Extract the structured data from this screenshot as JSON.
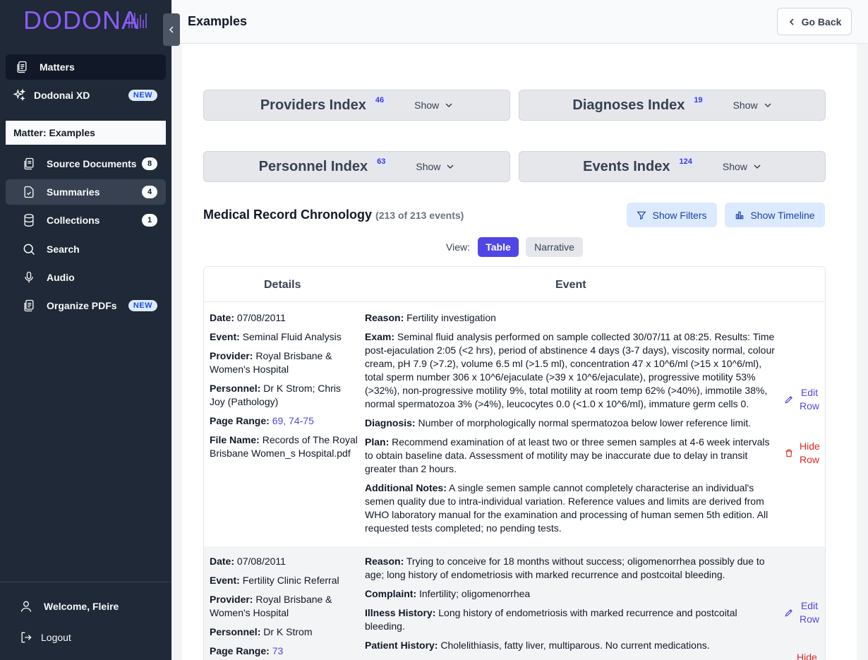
{
  "sidebar": {
    "logo": "DODONA",
    "items": [
      {
        "label": "Matters",
        "icon": "document-stack-icon"
      },
      {
        "label": "Dodonai XD",
        "icon": "sparkles-icon",
        "badge": "NEW"
      }
    ],
    "matter_label": "Matter: Examples",
    "sub_items": [
      {
        "label": "Source Documents",
        "icon": "documents-icon",
        "count": "8"
      },
      {
        "label": "Summaries",
        "icon": "document-check-icon",
        "count": "4"
      },
      {
        "label": "Collections",
        "icon": "database-icon",
        "count": "1"
      },
      {
        "label": "Search",
        "icon": "search-icon"
      },
      {
        "label": "Audio",
        "icon": "microphone-icon"
      },
      {
        "label": "Organize PDFs",
        "icon": "document-stack-icon",
        "badge": "NEW"
      }
    ],
    "welcome": "Welcome, Fleire",
    "logout": "Logout"
  },
  "header": {
    "title": "Examples",
    "go_back": "Go Back"
  },
  "indexes": [
    {
      "title": "Providers Index",
      "count": "46",
      "show": "Show"
    },
    {
      "title": "Diagnoses Index",
      "count": "19",
      "show": "Show"
    },
    {
      "title": "Personnel Index",
      "count": "63",
      "show": "Show"
    },
    {
      "title": "Events Index",
      "count": "124",
      "show": "Show"
    }
  ],
  "chronology": {
    "title": "Medical Record Chronology",
    "count": "(213 of 213 events)",
    "show_filters": "Show Filters",
    "show_timeline": "Show Timeline",
    "view_label": "View:",
    "view_table": "Table",
    "view_narrative": "Narrative",
    "col_details": "Details",
    "col_event": "Event"
  },
  "rows": [
    {
      "date_label": "Date:",
      "date": "07/08/2011",
      "event_label": "Event:",
      "event": "Seminal Fluid Analysis",
      "provider_label": "Provider:",
      "provider": "Royal Brisbane & Women's Hospital",
      "personnel_label": "Personnel:",
      "personnel": "Dr K Strom; Chris Joy (Pathology)",
      "page_label": "Page Range:",
      "page": "69, 74-75",
      "file_label": "File Name:",
      "file": "Records of The Royal Brisbane Women_s Hospital.pdf",
      "reason_label": "Reason:",
      "reason": "Fertility investigation",
      "exam_label": "Exam:",
      "exam": "Seminal fluid analysis performed on sample collected 30/07/11 at 08:25. Results: Time post-ejaculation 2:05 (<2 hrs), period of abstinence 4 days (3-7 days), viscosity normal, colour cream, pH 7.9 (>7.2), volume 6.5 ml (>1.5 ml), concentration 47 x 10^6/ml (>15 x 10^6/ml), total sperm number 306 x 10^6/ejaculate (>39 x 10^6/ejaculate), progressive motility 53% (>32%), non-progressive motility 9%, total motility at room temp 62% (>40%), immotile 38%, normal spermatozoa 3% (>4%), leucocytes 0.0 (<1.0 x 10^6/ml), immature germ cells 0.",
      "diagnosis_label": "Diagnosis:",
      "diagnosis": "Number of morphologically normal spermatozoa below lower reference limit.",
      "plan_label": "Plan:",
      "plan": "Recommend examination of at least two or three semen samples at 4-6 week intervals to obtain baseline data. Assessment of motility may be inaccurate due to delay in transit greater than 2 hours.",
      "notes_label": "Additional Notes:",
      "notes": "A single semen sample cannot completely characterise an individual's semen quality due to intra-individual variation. Reference values and limits are derived from WHO laboratory manual for the examination and processing of human semen 5th edition. All requested tests completed; no pending tests.",
      "edit": "Edit Row",
      "hide": "Hide Row"
    },
    {
      "date_label": "Date:",
      "date": "07/08/2011",
      "event_label": "Event:",
      "event": "Fertility Clinic Referral",
      "provider_label": "Provider:",
      "provider": "Royal Brisbane & Women's Hospital",
      "personnel_label": "Personnel:",
      "personnel": "Dr K Strom",
      "page_label": "Page Range:",
      "page": "73",
      "reason_label": "Reason:",
      "reason": "Trying to conceive for 18 months without success; oligomenorrhea possibly due to age; long history of endometriosis with marked recurrence and postcoital bleeding.",
      "complaint_label": "Complaint:",
      "complaint": "Infertility; oligomenorrhea",
      "illness_label": "Illness History:",
      "illness": "Long history of endometriosis with marked recurrence and postcoital bleeding.",
      "history_label": "Patient History:",
      "history": "Cholelithiasis, fatty liver, multiparous. No current medications.",
      "edit": "Edit Row",
      "hide": "Hide"
    }
  ]
}
